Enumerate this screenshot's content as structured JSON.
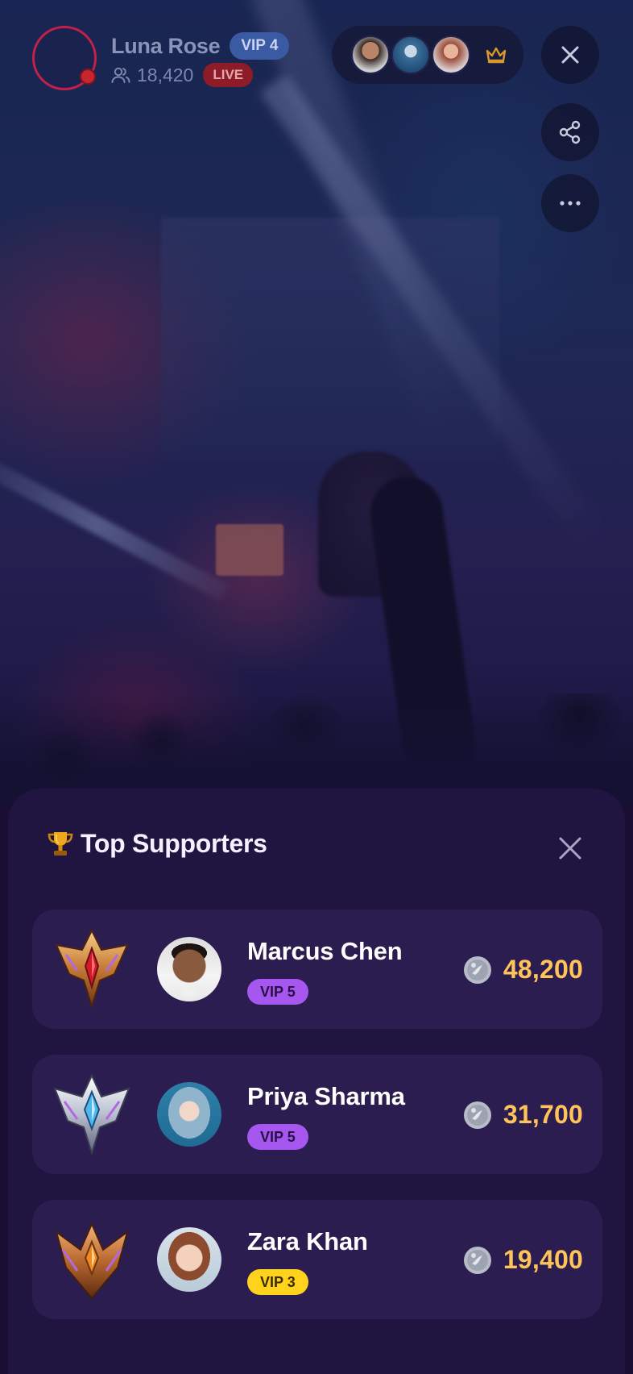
{
  "host": {
    "name": "Luna Rose",
    "vip_label": "VIP 4",
    "viewers": "18,420",
    "live_label": "LIVE"
  },
  "top_viewers": {
    "avatars": [
      "viewer-avatar-1",
      "viewer-avatar-2",
      "viewer-avatar-3"
    ],
    "icon": "crown-icon"
  },
  "controls": {
    "close_icon": "close-icon",
    "share_icon": "share-icon",
    "more_icon": "more-icon"
  },
  "sheet": {
    "title": "Top Supporters",
    "title_icon": "trophy-icon",
    "close_icon": "close-icon",
    "supporters": [
      {
        "name": "Marcus Chen",
        "vip": "VIP 5",
        "vip_color": "#a657f0",
        "coins": "48,200",
        "badge": "gold-crest-badge"
      },
      {
        "name": "Priya Sharma",
        "vip": "VIP 5",
        "vip_color": "#a657f0",
        "coins": "31,700",
        "badge": "silver-crest-badge"
      },
      {
        "name": "Zara Khan",
        "vip": "VIP 3",
        "vip_color": "#ffd21e",
        "coins": "19,400",
        "badge": "bronze-crest-badge"
      }
    ]
  },
  "colors": {
    "accent_gold": "#ffc35a",
    "sheet_bg": "#201440",
    "row_bg": "#2b1d4f",
    "live_red": "#8d1c28"
  }
}
